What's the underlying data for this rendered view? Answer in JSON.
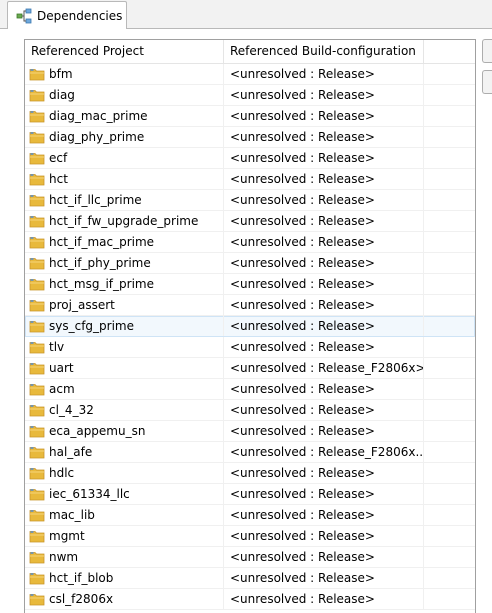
{
  "tab": {
    "label": "Dependencies",
    "icon": "dependencies-icon"
  },
  "table": {
    "columns": [
      "Referenced Project",
      "Referenced Build-configuration"
    ],
    "row_icon": "project-folder-icon",
    "highlighted_row": "sys_cfg_prime",
    "rows": [
      {
        "project": "bfm",
        "config": "<unresolved : Release>"
      },
      {
        "project": "diag",
        "config": "<unresolved : Release>"
      },
      {
        "project": "diag_mac_prime",
        "config": "<unresolved : Release>"
      },
      {
        "project": "diag_phy_prime",
        "config": "<unresolved : Release>"
      },
      {
        "project": "ecf",
        "config": "<unresolved : Release>"
      },
      {
        "project": "hct",
        "config": "<unresolved : Release>"
      },
      {
        "project": "hct_if_llc_prime",
        "config": "<unresolved : Release>"
      },
      {
        "project": "hct_if_fw_upgrade_prime",
        "config": "<unresolved : Release>"
      },
      {
        "project": "hct_if_mac_prime",
        "config": "<unresolved : Release>"
      },
      {
        "project": "hct_if_phy_prime",
        "config": "<unresolved : Release>"
      },
      {
        "project": "hct_msg_if_prime",
        "config": "<unresolved : Release>"
      },
      {
        "project": "proj_assert",
        "config": "<unresolved : Release>"
      },
      {
        "project": "sys_cfg_prime",
        "config": "<unresolved : Release>"
      },
      {
        "project": "tlv",
        "config": "<unresolved : Release>"
      },
      {
        "project": "uart",
        "config": "<unresolved : Release_F2806x>"
      },
      {
        "project": "acm",
        "config": "<unresolved : Release>"
      },
      {
        "project": "cl_4_32",
        "config": "<unresolved : Release>"
      },
      {
        "project": "eca_appemu_sn",
        "config": "<unresolved : Release>"
      },
      {
        "project": "hal_afe",
        "config": "<unresolved : Release_F2806x..."
      },
      {
        "project": "hdlc",
        "config": "<unresolved : Release>"
      },
      {
        "project": "iec_61334_llc",
        "config": "<unresolved : Release>"
      },
      {
        "project": "mac_lib",
        "config": "<unresolved : Release>"
      },
      {
        "project": "mgmt",
        "config": "<unresolved : Release>"
      },
      {
        "project": "nwm",
        "config": "<unresolved : Release>"
      },
      {
        "project": "hct_if_blob",
        "config": "<unresolved : Release>"
      },
      {
        "project": "csl_f2806x",
        "config": "<unresolved : Release>"
      }
    ]
  },
  "colors": {
    "folder": "#e8b93c",
    "folder_dark": "#c9952a",
    "highlight": "#f2f8fd"
  }
}
